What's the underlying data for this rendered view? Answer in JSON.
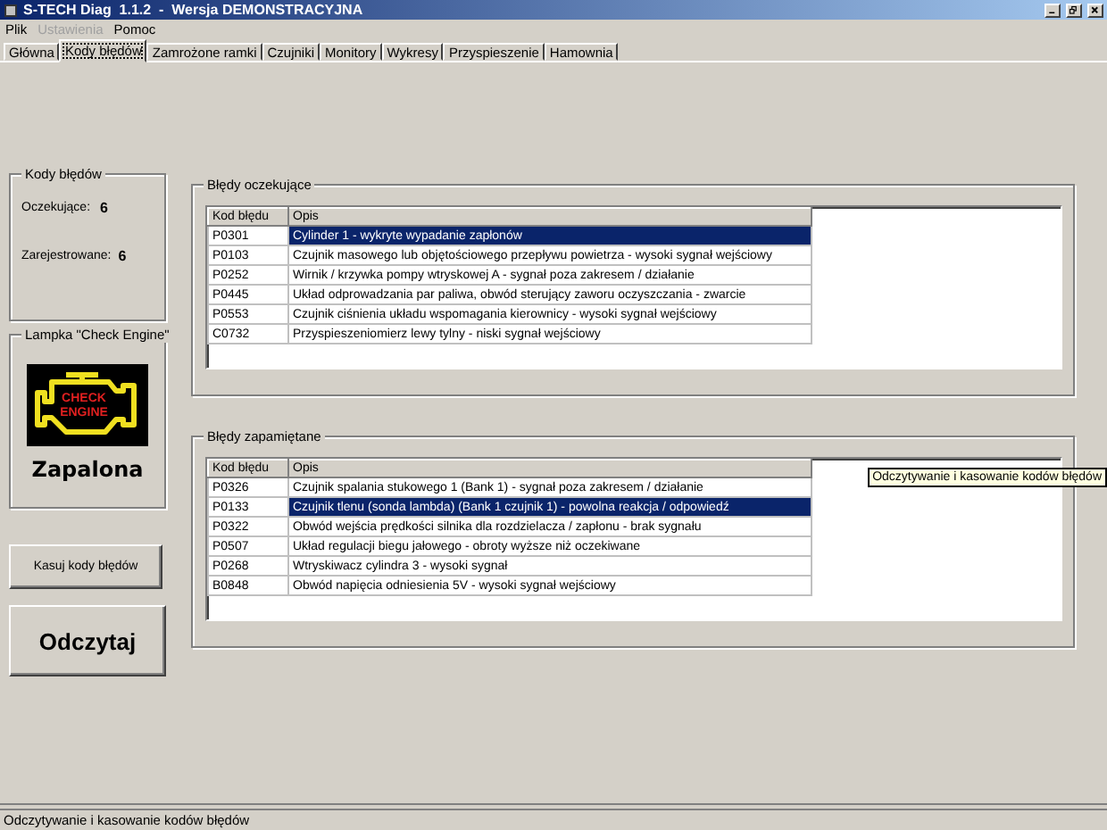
{
  "window": {
    "title": "S-TECH Diag  1.1.2  -  Wersja DEMONSTRACYJNA"
  },
  "menu": [
    {
      "label": "Plik",
      "disabled": false
    },
    {
      "label": "Ustawienia",
      "disabled": true
    },
    {
      "label": "Pomoc",
      "disabled": false
    }
  ],
  "tabs": [
    {
      "label": "Główna",
      "selected": false
    },
    {
      "label": "Kody błędów",
      "selected": true
    },
    {
      "label": "Zamrożone ramki",
      "selected": false
    },
    {
      "label": "Czujniki",
      "selected": false
    },
    {
      "label": "Monitory",
      "selected": false
    },
    {
      "label": "Wykresy",
      "selected": false
    },
    {
      "label": "Przyspieszenie",
      "selected": false
    },
    {
      "label": "Hamownia",
      "selected": false
    }
  ],
  "code_counts": {
    "title": "Kody błędów",
    "rows": [
      {
        "label": "Oczekujące:",
        "value": "6"
      },
      {
        "label": "Zarejestrowane:",
        "value": "6"
      }
    ]
  },
  "lamp": {
    "title": "Lampka \"Check Engine\"",
    "lit": true,
    "icon_text": [
      "CHECK",
      "ENGINE"
    ],
    "status": "Zapalona"
  },
  "buttons": [
    {
      "label": "Kasuj kody błędów",
      "kind": "small"
    },
    {
      "label": "Odczytaj",
      "kind": "large"
    }
  ],
  "pending": {
    "title": "Błędy oczekujące",
    "columns": [
      "Kod błędu",
      "Opis"
    ],
    "rows": [
      {
        "code": "P0301",
        "description": "Cylinder 1 - wykryte wypadanie zapłonów",
        "selected": true
      },
      {
        "code": "P0103",
        "description": "Czujnik masowego lub objętościowego przepływu powietrza - wysoki sygnał wejściowy",
        "selected": false
      },
      {
        "code": "P0252",
        "description": "Wirnik / krzywka pompy wtryskowej A - sygnał poza zakresem / działanie",
        "selected": false
      },
      {
        "code": "P0445",
        "description": "Układ odprowadzania par paliwa, obwód sterujący zaworu oczyszczania - zwarcie",
        "selected": false
      },
      {
        "code": "P0553",
        "description": "Czujnik ciśnienia układu wspomagania kierownicy - wysoki sygnał wejściowy",
        "selected": false
      },
      {
        "code": "C0732",
        "description": "Przyspieszeniomierz lewy tylny - niski sygnał wejściowy",
        "selected": false
      }
    ]
  },
  "stored": {
    "title": "Błędy zapamiętane",
    "columns": [
      "Kod błędu",
      "Opis"
    ],
    "rows": [
      {
        "code": "P0326",
        "description": "Czujnik spalania stukowego 1 (Bank 1) - sygnał poza zakresem / działanie",
        "selected": false
      },
      {
        "code": "P0133",
        "description": "Czujnik tlenu (sonda lambda) (Bank 1 czujnik 1) - powolna reakcja / odpowiedź",
        "selected": true
      },
      {
        "code": "P0322",
        "description": "Obwód wejścia prędkości silnika dla rozdzielacza / zapłonu - brak sygnału",
        "selected": false
      },
      {
        "code": "P0507",
        "description": "Układ regulacji biegu jałowego - obroty wyższe niż oczekiwane",
        "selected": false
      },
      {
        "code": "P0268",
        "description": "Wtryskiwacz cylindra 3 - wysoki sygnał",
        "selected": false
      },
      {
        "code": "B0848",
        "description": "Obwód napięcia odniesienia 5V - wysoki sygnał wejściowy",
        "selected": false
      }
    ]
  },
  "tooltip": "Odczytywanie i kasowanie kodów błędów",
  "status_bar": "Odczytywanie i kasowanie kodów błędów"
}
